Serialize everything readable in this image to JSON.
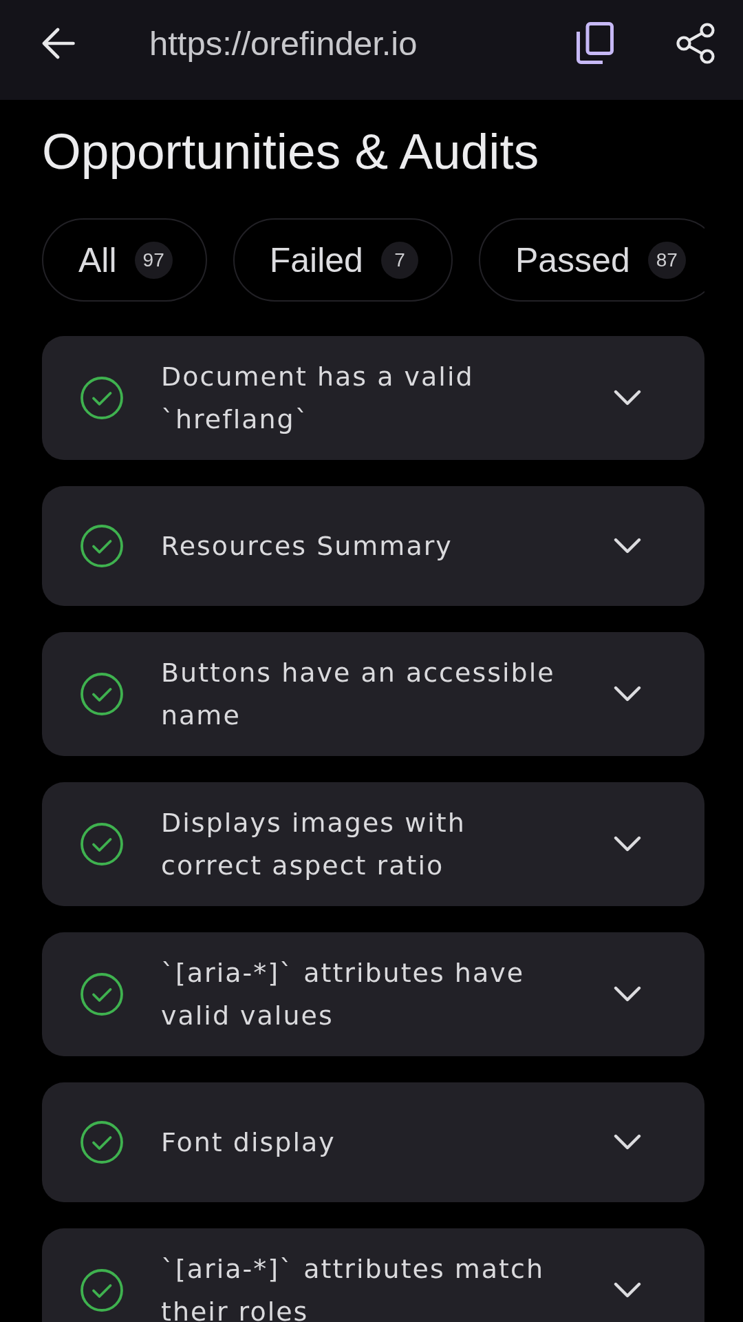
{
  "top_bar": {
    "url": "https://orefinder.io"
  },
  "title": "Opportunities & Audits",
  "filters": [
    {
      "label": "All",
      "count": "97"
    },
    {
      "label": "Failed",
      "count": "7"
    },
    {
      "label": "Passed",
      "count": "87"
    }
  ],
  "audits": [
    {
      "title": "Document has a valid `hreflang`",
      "kind": "passed",
      "expanded": false
    },
    {
      "title": "Resources Summary",
      "kind": "passed",
      "expanded": false
    },
    {
      "title": "Buttons have an accessible name",
      "kind": "passed",
      "expanded": false
    },
    {
      "title": "Displays images with correct aspect ratio",
      "kind": "passed",
      "expanded": false
    },
    {
      "title": "`[aria-*]` attributes have valid values",
      "kind": "passed",
      "expanded": false
    },
    {
      "title": "Font display",
      "kind": "passed",
      "expanded": false
    },
    {
      "title": "`[aria-*]` attributes match their roles",
      "kind": "passed",
      "expanded": false
    }
  ]
}
